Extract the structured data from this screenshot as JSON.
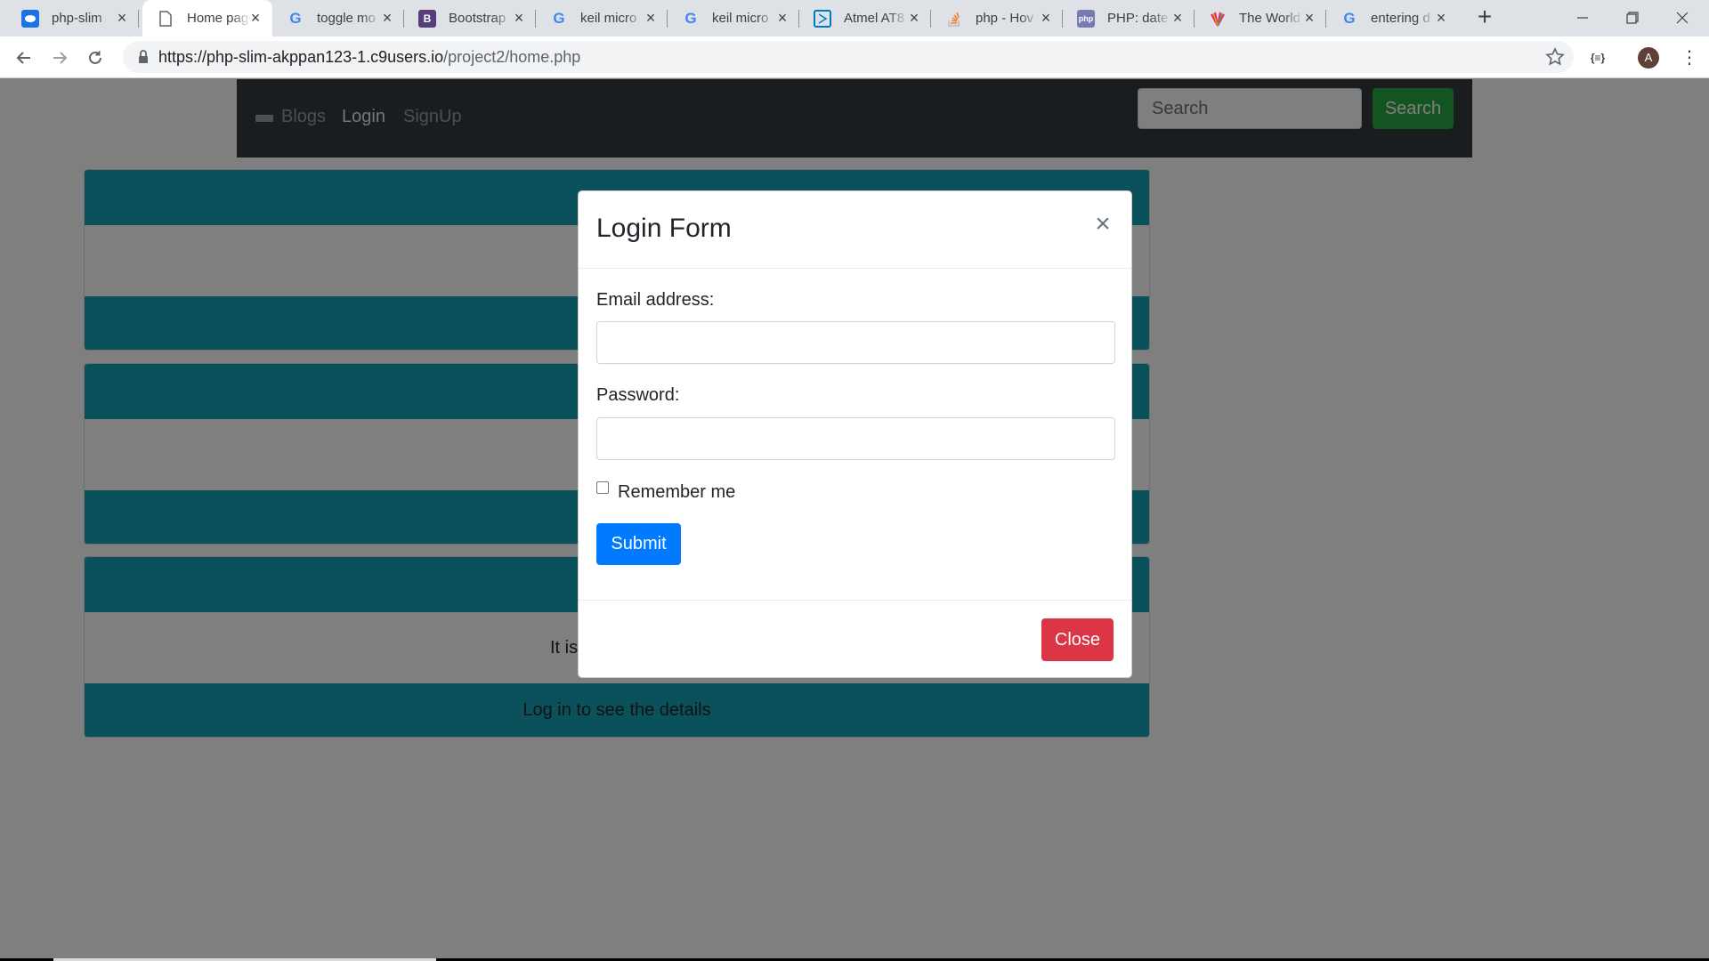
{
  "browser": {
    "tabs": [
      {
        "title": "php-slim",
        "favicon": "cloud9-icon",
        "color": "#1a73e8"
      },
      {
        "title": "Home page",
        "favicon": "page-icon",
        "color": "#5f6368"
      },
      {
        "title": "toggle mo",
        "favicon": "google-icon",
        "color": "#4285f4"
      },
      {
        "title": "Bootstrap",
        "favicon": "bootstrap-icon",
        "color": "#563d7c"
      },
      {
        "title": "keil micro",
        "favicon": "google-icon",
        "color": "#4285f4"
      },
      {
        "title": "keil micro",
        "favicon": "google-icon",
        "color": "#4285f4"
      },
      {
        "title": "Atmel AT8",
        "favicon": "atmel-icon",
        "color": "#0079c1"
      },
      {
        "title": "php - Hov",
        "favicon": "stackoverflow-icon",
        "color": "#f48024"
      },
      {
        "title": "PHP: date",
        "favicon": "php-icon",
        "color": "#777bb3"
      },
      {
        "title": "The World",
        "favicon": "world-icon",
        "color": "#e91e63"
      },
      {
        "title": "entering d",
        "favicon": "google-icon",
        "color": "#4285f4"
      }
    ],
    "url_host": "https://php-slim-akppan123-1.c9users.io",
    "url_path": "/project2/home.php",
    "avatar_letter": "A",
    "ext_label": "{≡}"
  },
  "navbar": {
    "links": [
      "Blogs",
      "Login",
      "SignUp"
    ],
    "search_placeholder": "Search",
    "search_button": "Search"
  },
  "cards": [
    {
      "body": "",
      "footer": ""
    },
    {
      "body": "",
      "footer": ""
    },
    {
      "body": "It is my first blog.",
      "footer": "Log in to see the details"
    }
  ],
  "modal": {
    "title": "Login Form",
    "close_x": "×",
    "email_label": "Email address:",
    "email_value": "",
    "password_label": "Password:",
    "password_value": "",
    "remember_label": "Remember me",
    "submit_label": "Submit",
    "close_label": "Close"
  },
  "colors": {
    "navbar_bg": "#343a40",
    "card_accent": "#17a2b8",
    "primary": "#007bff",
    "success": "#28a745",
    "danger": "#dc3545"
  }
}
